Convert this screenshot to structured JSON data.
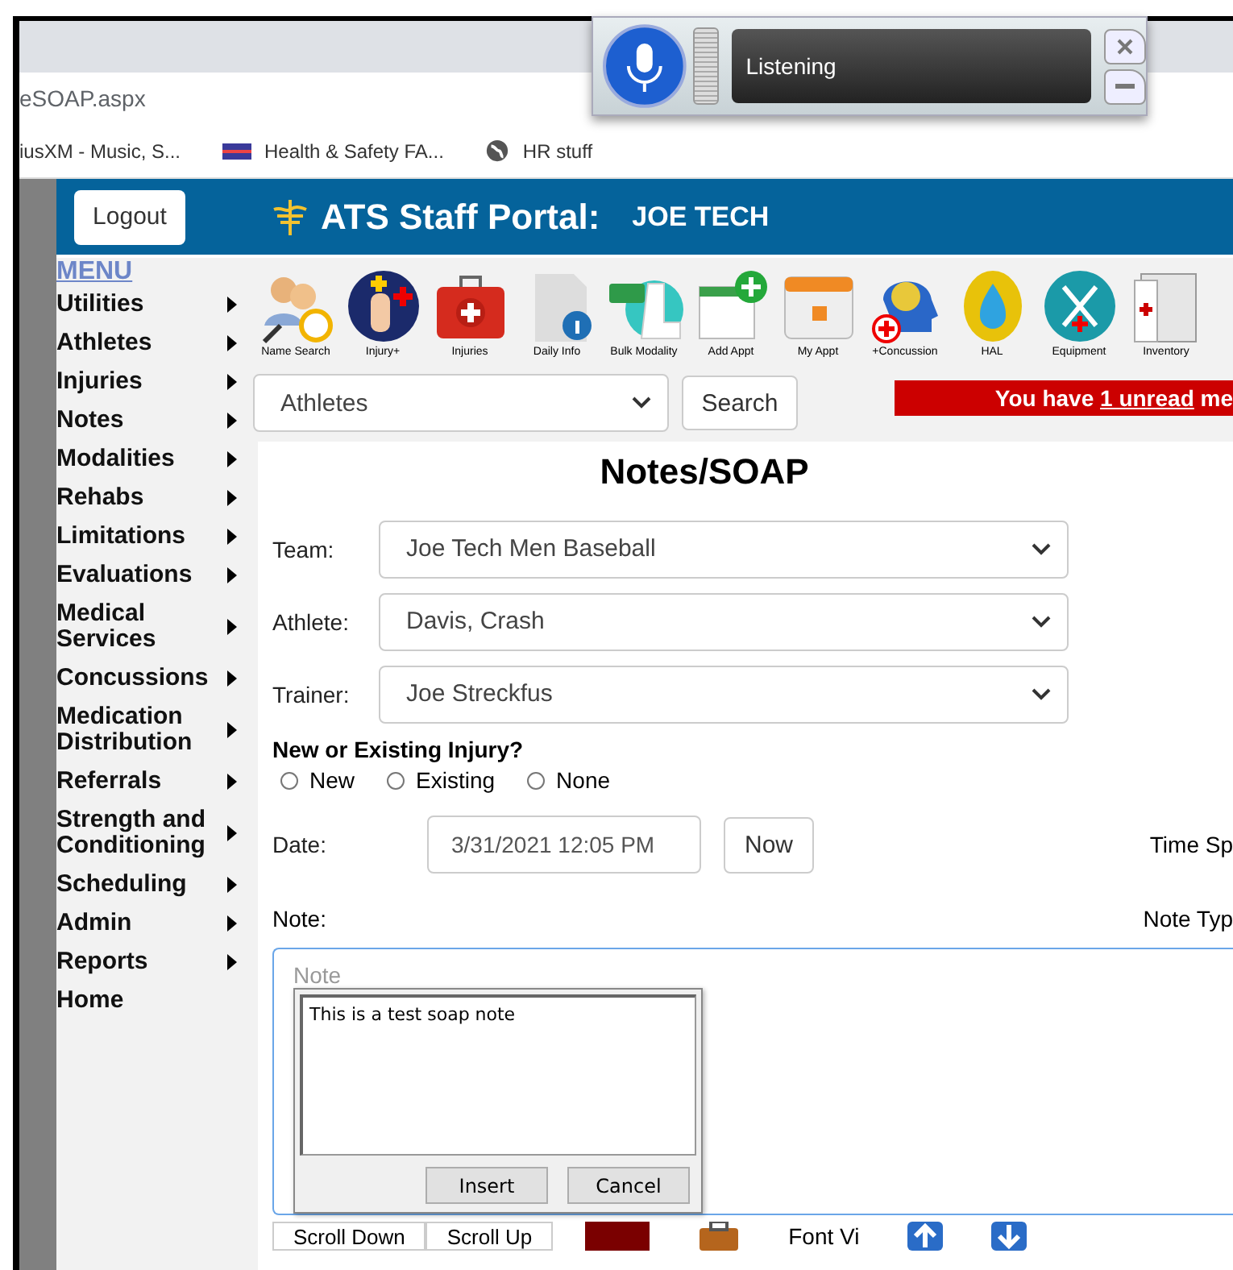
{
  "browser": {
    "address": "eSOAP.aspx",
    "bookmarks": [
      {
        "label": "iusXM - Music, S...",
        "kind": "none"
      },
      {
        "label": "Health & Safety FA...",
        "kind": "flag"
      },
      {
        "label": "HR stuff",
        "kind": "globe"
      }
    ]
  },
  "speech": {
    "status": "Listening"
  },
  "header": {
    "logout": "Logout",
    "title": "ATS Staff Portal:",
    "user": "JOE TECH"
  },
  "menu": {
    "title": "MENU",
    "items": [
      {
        "label": "Utilities",
        "submenu": true
      },
      {
        "label": "Athletes",
        "submenu": true
      },
      {
        "label": "Injuries",
        "submenu": true
      },
      {
        "label": "Notes",
        "submenu": true
      },
      {
        "label": "Modalities",
        "submenu": true
      },
      {
        "label": "Rehabs",
        "submenu": true
      },
      {
        "label": "Limitations",
        "submenu": true
      },
      {
        "label": "Evaluations",
        "submenu": true
      },
      {
        "label": "Medical Services",
        "submenu": true
      },
      {
        "label": "Concussions",
        "submenu": true
      },
      {
        "label": "Medication Distribution",
        "submenu": true
      },
      {
        "label": "Referrals",
        "submenu": true
      },
      {
        "label": "Strength and Conditioning",
        "submenu": true
      },
      {
        "label": "Scheduling",
        "submenu": true
      },
      {
        "label": "Admin",
        "submenu": true
      },
      {
        "label": "Reports",
        "submenu": true
      },
      {
        "label": "Home",
        "submenu": false
      }
    ]
  },
  "toolbar": [
    {
      "label": "Name Search",
      "kind": "people"
    },
    {
      "label": "Injury+",
      "kind": "knee"
    },
    {
      "label": "Injuries",
      "kind": "kit"
    },
    {
      "label": "Daily Info",
      "kind": "daily"
    },
    {
      "label": "Bulk Modality",
      "kind": "bulk"
    },
    {
      "label": "Add Appt",
      "kind": "addappt"
    },
    {
      "label": "My Appt",
      "kind": "calendar"
    },
    {
      "label": "+Concussion",
      "kind": "head"
    },
    {
      "label": "HAL",
      "kind": "drop"
    },
    {
      "label": "Equipment",
      "kind": "crutch"
    },
    {
      "label": "Inventory",
      "kind": "cabinet"
    }
  ],
  "search": {
    "category": "Athletes",
    "button": "Search"
  },
  "alert": {
    "before": "You have",
    "link": "1 unread",
    "after": "me"
  },
  "form": {
    "title": "Notes/SOAP",
    "selects": [
      {
        "label": "Team:",
        "value": "Joe Tech Men Baseball"
      },
      {
        "label": "Athlete:",
        "value": "Davis, Crash"
      },
      {
        "label": "Trainer:",
        "value": "Joe Streckfus"
      }
    ],
    "injury_question": "New or Existing Injury?",
    "injury_options": [
      {
        "label": "New",
        "selected": false
      },
      {
        "label": "Existing",
        "selected": false
      },
      {
        "label": "None",
        "selected": false
      }
    ],
    "date_label": "Date:",
    "date_value": "3/31/2021 12:05 PM",
    "now_button": "Now",
    "time_label": "Time Sp",
    "note_label": "Note:",
    "note_type_label": "Note Typ",
    "note_placeholder": "Note",
    "bottom_buttons": [
      "Scroll Down",
      "Scroll Up"
    ],
    "font_label": "Font Vi"
  },
  "dictation": {
    "text": "This is a test soap note",
    "buttons": [
      "Insert",
      "Cancel"
    ]
  }
}
